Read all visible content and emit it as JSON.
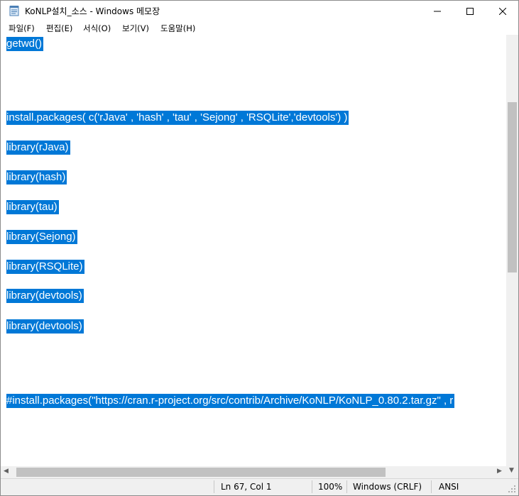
{
  "window": {
    "title": "KoNLP설치_소스 - Windows 메모장",
    "controls": {
      "minimize": "minimize",
      "maximize": "maximize",
      "close": "close"
    }
  },
  "menu": {
    "file": "파일(F)",
    "edit": "편집(E)",
    "format": "서식(O)",
    "view": "보기(V)",
    "help": "도움말(H)"
  },
  "editor": {
    "lines": [
      "getwd()",
      "install.packages( c('rJava' , 'hash' , 'tau' , 'Sejong' , 'RSQLite','devtools') )",
      "library(rJava)",
      "library(hash)",
      "library(tau)",
      "library(Sejong)",
      "library(RSQLite)",
      "library(devtools)",
      "library(devtools)",
      "#install.packages(\"https://cran.r-project.org/src/contrib/Archive/KoNLP/KoNLP_0.80.2.tar.gz\" , r"
    ],
    "selection_color": "#0078d7"
  },
  "status": {
    "position": "Ln 67, Col 1",
    "zoom": "100%",
    "line_ending": "Windows (CRLF)",
    "encoding": "ANSI"
  }
}
